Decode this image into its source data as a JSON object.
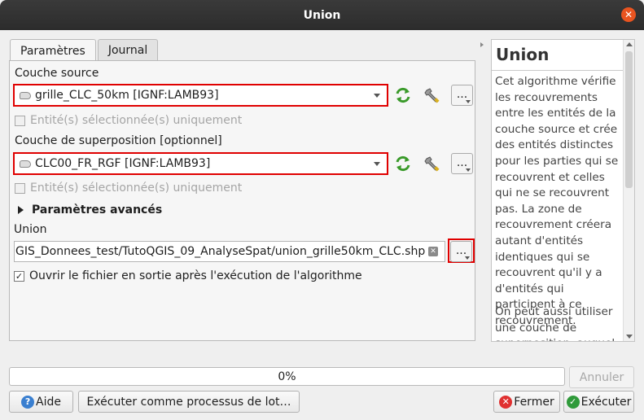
{
  "window": {
    "title": "Union"
  },
  "tabs": [
    "Paramètres",
    "Journal"
  ],
  "params": {
    "source_label": "Couche source",
    "source_value": "grille_CLC_50km [IGNF:LAMB93]",
    "selected_only_1": "Entité(s) sélectionnée(s) uniquement",
    "overlay_label": "Couche de superposition [optionnel]",
    "overlay_value": "CLC00_FR_RGF [IGNF:LAMB93]",
    "selected_only_2": "Entité(s) sélectionnée(s) uniquement",
    "advanced": "Paramètres avancés",
    "output_label": "Union",
    "output_value": "GIS_Donnees_test/TutoQGIS_09_AnalyseSpat/union_grille50km_CLC.shp",
    "open_after": "Ouvrir le fichier en sortie après l'exécution de l'algorithme",
    "dots": "..."
  },
  "help": {
    "title": "Union",
    "p1": "Cet algorithme vérifie les recouvrements entre les entités de la couche source et crée des entités distinctes pour les parties qui se recouvrent et celles qui ne se recouvrent pas. La zone de recouvrement créera autant d'entités identiques qui se recouvrent qu'il y a d'entités qui participent à ce recouvrement.",
    "p2": "On peut aussi utiliser une couche de superposition, auquel"
  },
  "progress": {
    "text": "0%",
    "value": 0
  },
  "buttons": {
    "cancel": "Annuler",
    "help": "Aide",
    "batch": "Exécuter comme processus de lot…",
    "close": "Fermer",
    "run": "Exécuter"
  },
  "colors": {
    "highlight": "#e00000",
    "title_bg": "#2c2c2c",
    "close_orange": "#e95420"
  },
  "icons": [
    "layer-polygon-icon",
    "iterate-icon",
    "wrench-icon",
    "clear-icon",
    "help-icon",
    "close-circle-icon",
    "run-check-icon"
  ]
}
